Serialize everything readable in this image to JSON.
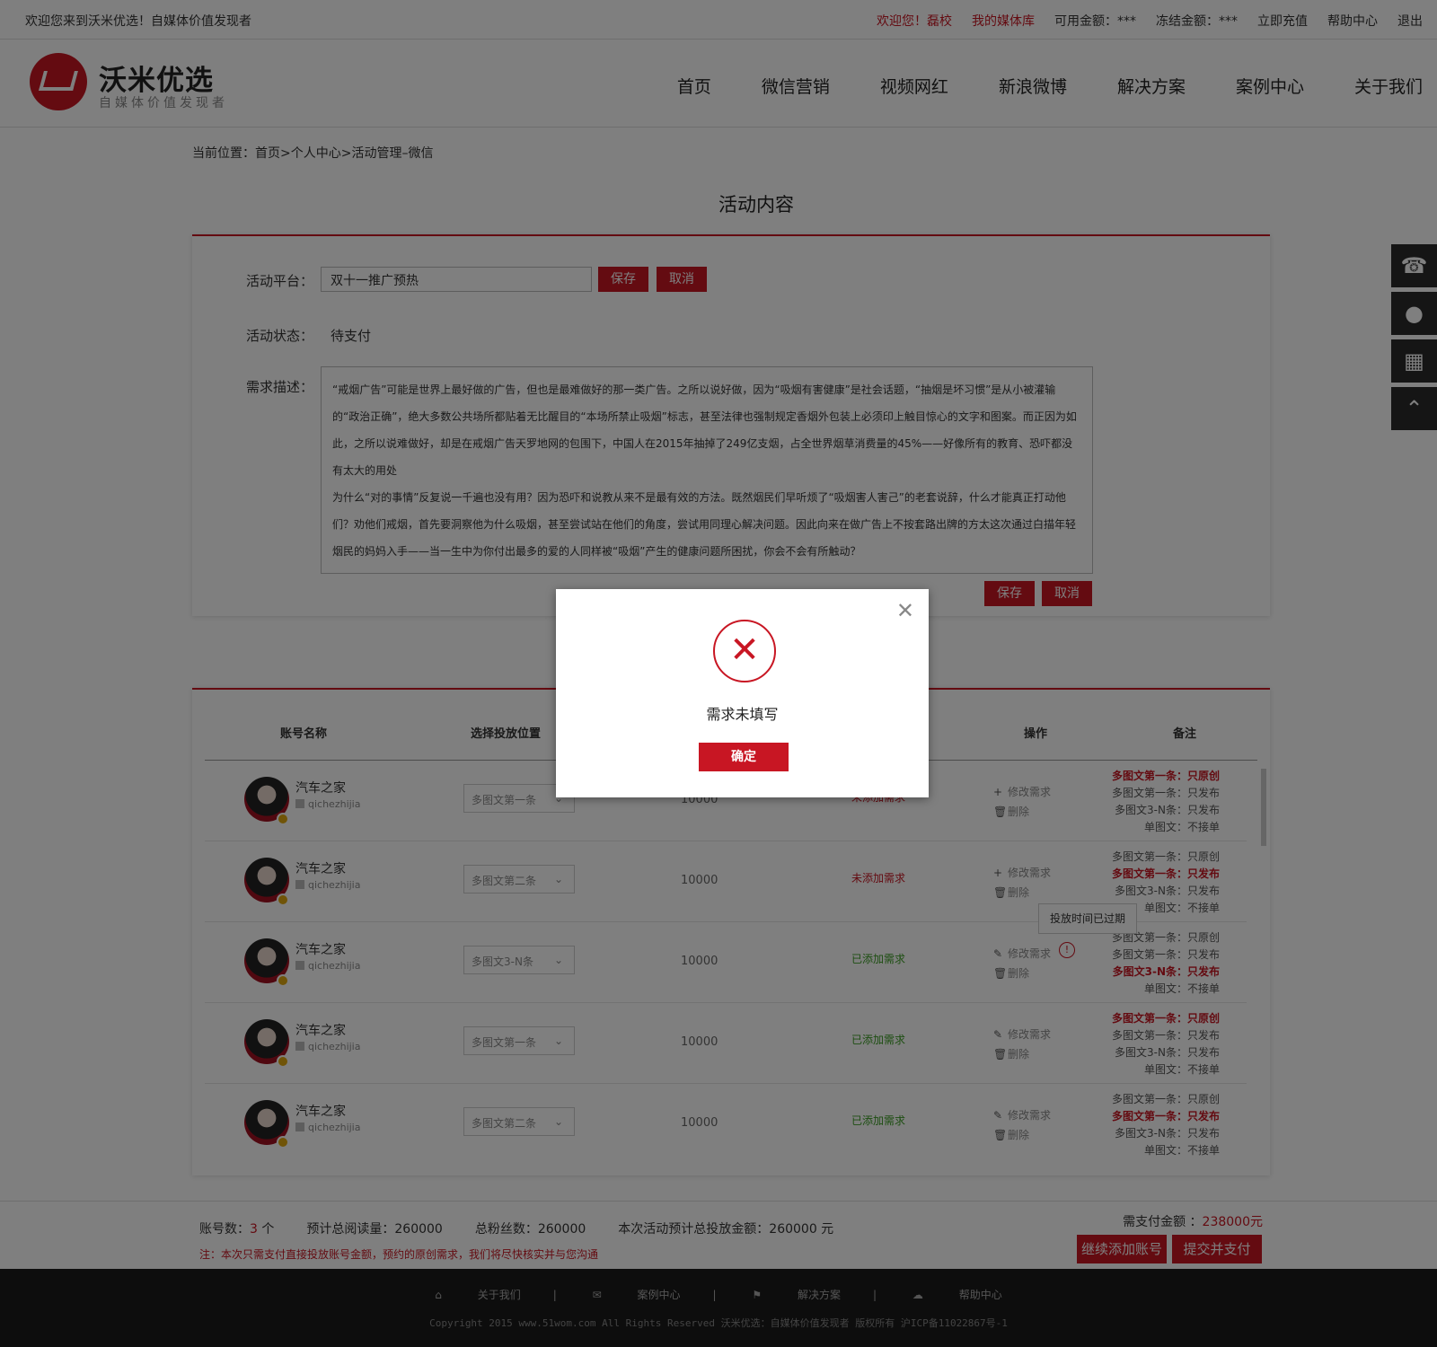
{
  "topbar": {
    "welcome": "欢迎您来到沃米优选！自媒体价值发现者",
    "user": "欢迎您！磊校",
    "media_lib": "我的媒体库",
    "available": "可用金额：***",
    "frozen": "冻结金额：***",
    "recharge": "立即充值",
    "help": "帮助中心",
    "logout": "退出"
  },
  "header": {
    "logo_title": "沃米优选",
    "logo_sub": "自媒体价值发现者",
    "nav": [
      "首页",
      "微信营销",
      "视频网红",
      "新浪微博",
      "解决方案",
      "案例中心",
      "关于我们"
    ]
  },
  "breadcrumb": "当前位置：首页>个人中心>活动管理–微信",
  "page_title": "活动内容",
  "activity": {
    "platform_label": "活动平台：",
    "platform_value": "双十一推广预热",
    "save": "保存",
    "cancel": "取消",
    "status_label": "活动状态：",
    "status_value": "待支付",
    "desc_label": "需求描述：",
    "desc_p1": "“戒烟广告”可能是世界上最好做的广告，但也是最难做好的那一类广告。之所以说好做，因为“吸烟有害健康”是社会话题，“抽烟是坏习惯”是从小被灌输的“政治正确”，绝大多数公共场所都贴着无比醒目的“本场所禁止吸烟”标志，甚至法律也强制规定香烟外包装上必须印上触目惊心的文字和图案。而正因为如此，之所以说难做好，却是在戒烟广告天罗地网的包围下，中国人在2015年抽掉了249亿支烟，占全世界烟草消费量的45%——好像所有的教育、恐吓都没有太大的用处",
    "desc_p2": "为什么“对的事情”反复说一千遍也没有用？因为恐吓和说教从来不是最有效的方法。既然烟民们早听烦了“吸烟害人害己”的老套说辞，什么才能真正打动他们？劝他们戒烟，首先要洞察他为什么吸烟，甚至尝试站在他们的角度，尝试用同理心解决问题。因此向来在做广告上不按套路出牌的方太这次通过白描年轻烟民的妈妈入手——当一生中为你付出最多的爱的人同样被“吸烟”产生的健康问题所困扰，你会不会有所触动？"
  },
  "table": {
    "headers": {
      "account": "账号名称",
      "position": "选择投放位置",
      "ops": "操作",
      "notes": "备注"
    },
    "rows": [
      {
        "name": "汽车之家",
        "id": "qichezhijia",
        "position": "多图文第一条",
        "reads": "10000",
        "need": "未添加需求",
        "op1": "修改需求",
        "op2": "删除"
      },
      {
        "name": "汽车之家",
        "id": "qichezhijia",
        "position": "多图文第二条",
        "reads": "10000",
        "need": "未添加需求",
        "op1": "修改需求",
        "op2": "删除"
      },
      {
        "name": "汽车之家",
        "id": "qichezhijia",
        "position": "多图文3-N条",
        "reads": "10000",
        "need": "已添加需求",
        "op1": "修改需求",
        "op2": "删除"
      },
      {
        "name": "汽车之家",
        "id": "qichezhijia",
        "position": "多图文第一条",
        "reads": "10000",
        "need": "已添加需求",
        "op1": "修改需求",
        "op2": "删除"
      },
      {
        "name": "汽车之家",
        "id": "qichezhijia",
        "position": "多图文第二条",
        "reads": "10000",
        "need": "已添加需求",
        "op1": "修改需求",
        "op2": "删除"
      }
    ],
    "notes": [
      [
        "多图文第一条：只原创",
        "多图文第一条：只发布",
        "多图文3-N条：只发布",
        "单图文：不接单"
      ],
      [
        "多图文第一条：只原创",
        "多图文第一条：只发布",
        "多图文3-N条：只发布",
        "单图文：不接单"
      ],
      [
        "多图文第一条：只原创",
        "多图文第一条：只发布",
        "多图文3-N条：只发布",
        "单图文：不接单"
      ],
      [
        "多图文第一条：只原创",
        "多图文第一条：只发布",
        "多图文3-N条：只发布",
        "单图文：不接单"
      ],
      [
        "多图文第一条：只原创",
        "多图文第一条：只发布",
        "多图文3-N条：只发布",
        "单图文：不接单"
      ]
    ],
    "tooltip": "投放时间已过期"
  },
  "summary": {
    "count_label": "账号数：",
    "count_value": "3",
    "count_unit": "个",
    "reads": "预计总阅读量：260000",
    "fans": "总粉丝数：260000",
    "total": "本次活动预计总投放金额：260000 元",
    "note": "注：本次只需支付直接投放账号金额，预约的原创需求，我们将尽快核实并与您沟通",
    "pay_label": "需支付金额 ：",
    "pay_amount": "238000元",
    "add_btn": "继续添加账号",
    "submit_btn": "提交并支付"
  },
  "footer": {
    "links": [
      "关于我们",
      "案例中心",
      "解决方案",
      "帮助中心"
    ],
    "copyright": "Copyright 2015 www.51wom.com All Rights Reserved 沃米优选：自媒体价值发现者 版权所有 沪ICP备11022867号-1"
  },
  "modal": {
    "message": "需求未填写",
    "confirm": "确定"
  },
  "colors": {
    "brand": "#c81623",
    "success": "#3a9d23"
  }
}
